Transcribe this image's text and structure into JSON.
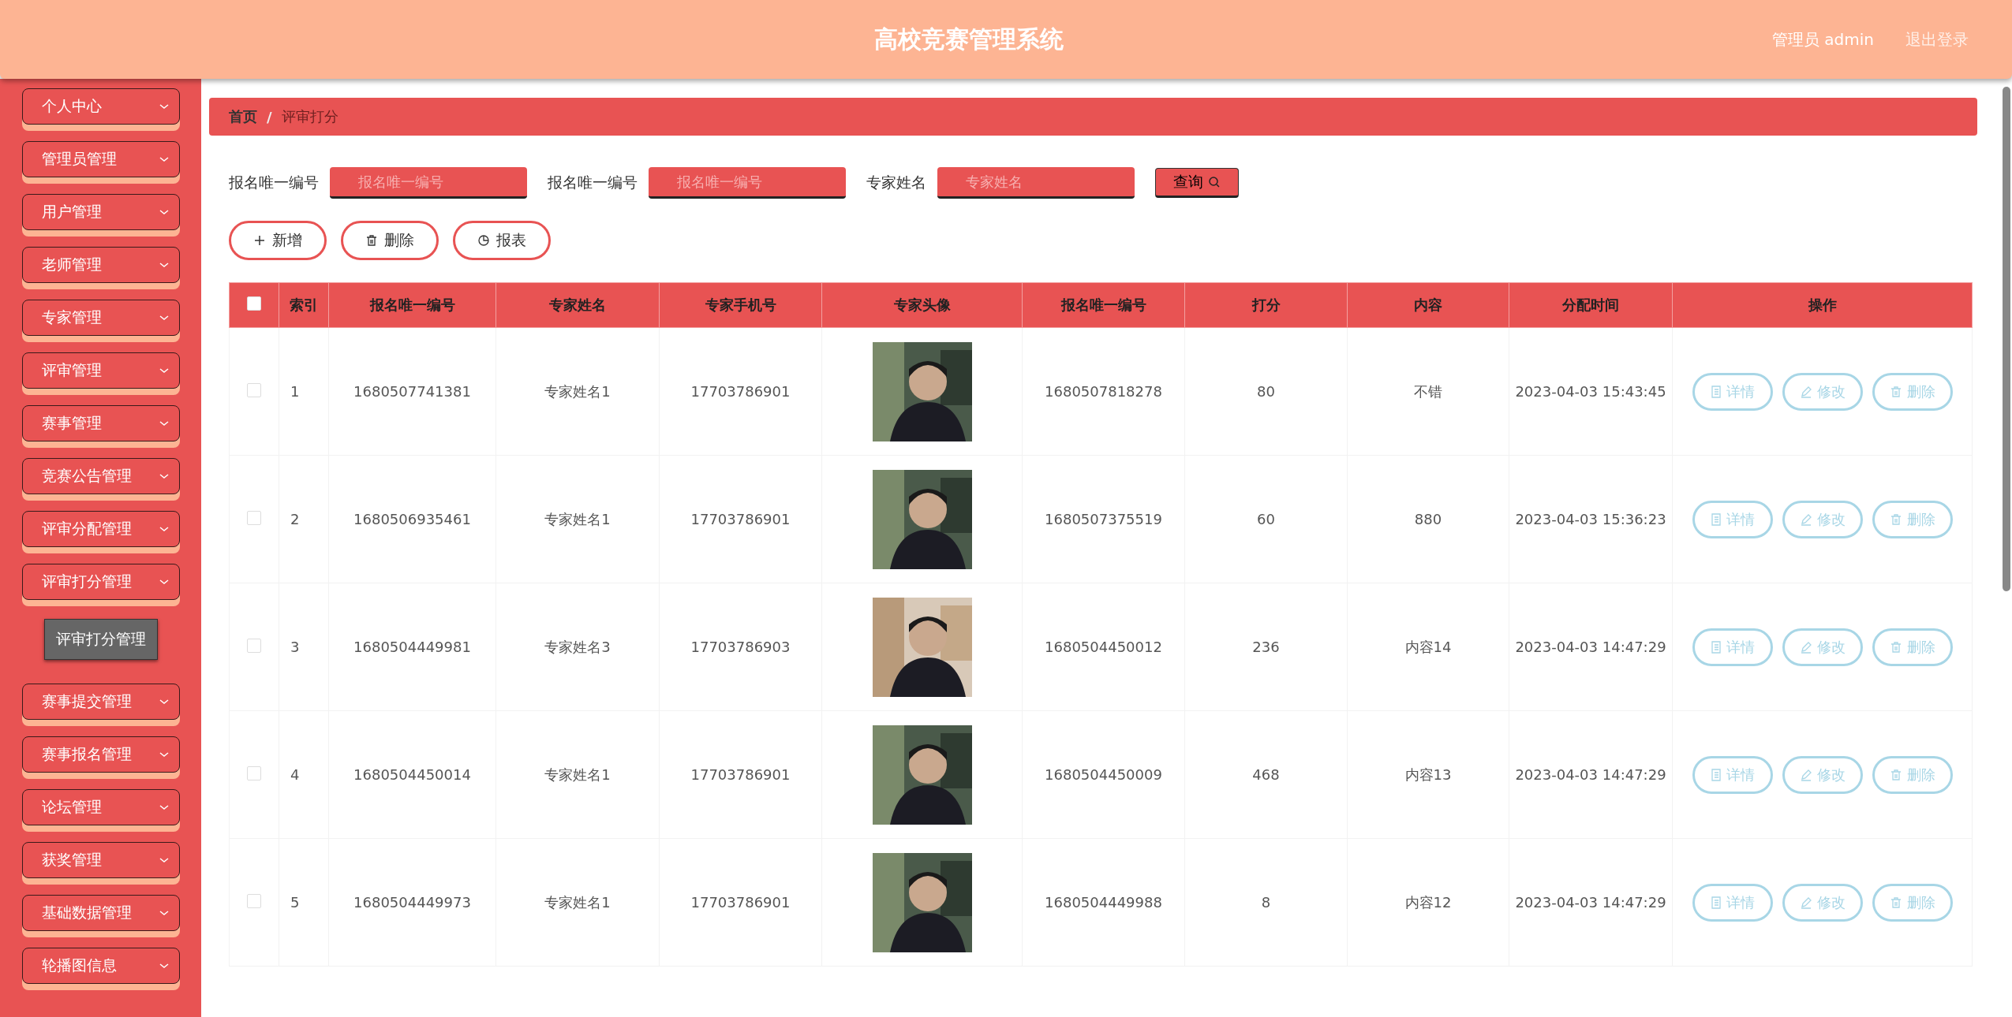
{
  "header": {
    "title": "高校竞赛管理系统",
    "user": "管理员 admin",
    "logout": "退出登录"
  },
  "sidebar": {
    "items": [
      {
        "label": "个人中心"
      },
      {
        "label": "管理员管理"
      },
      {
        "label": "用户管理"
      },
      {
        "label": "老师管理"
      },
      {
        "label": "专家管理"
      },
      {
        "label": "评审管理"
      },
      {
        "label": "赛事管理"
      },
      {
        "label": "竞赛公告管理"
      },
      {
        "label": "评审分配管理"
      },
      {
        "label": "评审打分管理",
        "children": [
          {
            "label": "评审打分管理"
          }
        ]
      },
      {
        "label": "赛事提交管理"
      },
      {
        "label": "赛事报名管理"
      },
      {
        "label": "论坛管理"
      },
      {
        "label": "获奖管理"
      },
      {
        "label": "基础数据管理"
      },
      {
        "label": "轮播图信息"
      }
    ]
  },
  "breadcrumb": {
    "items": [
      "首页",
      "评审打分"
    ],
    "separator": "/"
  },
  "search": {
    "fields": [
      {
        "label": "报名唯一编号",
        "placeholder": "报名唯一编号"
      },
      {
        "label": "报名唯一编号",
        "placeholder": "报名唯一编号"
      },
      {
        "label": "专家姓名",
        "placeholder": "专家姓名"
      }
    ],
    "button": "查询"
  },
  "actions": [
    {
      "kind": "add",
      "label": "新增"
    },
    {
      "kind": "delete",
      "label": "删除"
    },
    {
      "kind": "report",
      "label": "报表"
    }
  ],
  "table": {
    "select_all_checked": false,
    "columns": [
      "索引",
      "报名唯一编号",
      "专家姓名",
      "专家手机号",
      "专家头像",
      "报名唯一编号",
      "打分",
      "内容",
      "分配时间",
      "操作"
    ],
    "rows": [
      {
        "checked": false,
        "cells": [
          "1",
          "1680507741381",
          "专家姓名1",
          "17703786901",
          {
            "kind": "picture"
          },
          "1680507818278",
          "80",
          "不错",
          "2023-04-03 15:43:45"
        ],
        "actions": [
          {
            "kind": "detail",
            "label": "详情"
          },
          {
            "kind": "edit",
            "label": "修改"
          },
          {
            "kind": "delete",
            "label": "删除"
          }
        ]
      },
      {
        "checked": false,
        "cells": [
          "2",
          "1680506935461",
          "专家姓名1",
          "17703786901",
          {
            "kind": "picture"
          },
          "1680507375519",
          "60",
          "880",
          "2023-04-03 15:36:23"
        ],
        "actions": [
          {
            "kind": "detail",
            "label": "详情"
          },
          {
            "kind": "edit",
            "label": "修改"
          },
          {
            "kind": "delete",
            "label": "删除"
          }
        ]
      },
      {
        "checked": false,
        "cells": [
          "3",
          "1680504449981",
          "专家姓名3",
          "17703786903",
          {
            "kind": "picture"
          },
          "1680504450012",
          "236",
          "内容14",
          "2023-04-03 14:47:29"
        ],
        "actions": [
          {
            "kind": "detail",
            "label": "详情"
          },
          {
            "kind": "edit",
            "label": "修改"
          },
          {
            "kind": "delete",
            "label": "删除"
          }
        ]
      },
      {
        "checked": false,
        "cells": [
          "4",
          "1680504450014",
          "专家姓名1",
          "17703786901",
          {
            "kind": "picture"
          },
          "1680504450009",
          "468",
          "内容13",
          "2023-04-03 14:47:29"
        ],
        "actions": [
          {
            "kind": "detail",
            "label": "详情"
          },
          {
            "kind": "edit",
            "label": "修改"
          },
          {
            "kind": "delete",
            "label": "删除"
          }
        ]
      },
      {
        "checked": false,
        "cells": [
          "5",
          "1680504449973",
          "专家姓名1",
          "17703786901",
          {
            "kind": "picture"
          },
          "1680504449988",
          "8",
          "内容12",
          "2023-04-03 14:47:29"
        ],
        "actions": [
          {
            "kind": "detail",
            "label": "详情"
          },
          {
            "kind": "edit",
            "label": "修改"
          },
          {
            "kind": "delete",
            "label": "删除"
          }
        ]
      }
    ]
  }
}
